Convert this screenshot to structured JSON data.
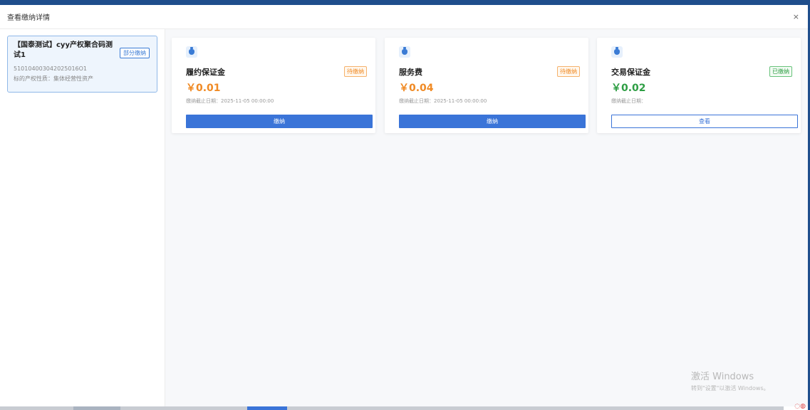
{
  "dialog": {
    "title": "查看缴纳详情",
    "close_label": "×"
  },
  "asset": {
    "title": "【国泰测试】cyy产权聚合码测试1",
    "badge": "部分缴纳",
    "code": "510104003042025016O1",
    "nature": "标的产权性质：集体经营性资产"
  },
  "fees": [
    {
      "name": "履约保证金",
      "status": "待缴纳",
      "amount": "￥0.01",
      "deadline": "缴纳截止日期：2025-11-05 00:00:00",
      "action": "缴纳"
    },
    {
      "name": "服务费",
      "status": "待缴纳",
      "amount": "￥0.04",
      "deadline": "缴纳截止日期：2025-11-05 00:00:00",
      "action": "缴纳"
    },
    {
      "name": "交易保证金",
      "status": "已缴纳",
      "amount": "￥0.02",
      "deadline": "缴纳截止日期：",
      "action": "查看"
    }
  ],
  "watermark": {
    "title": "激活 Windows",
    "subtitle": "转到\"设置\"以激活 Windows。"
  },
  "icons": {
    "fee": "money-bag-icon",
    "close": "close-icon"
  },
  "colors": {
    "accent": "#3a74d8",
    "pending": "#f08a24",
    "paid": "#2e9e44",
    "frame": "#1f4e8c"
  }
}
